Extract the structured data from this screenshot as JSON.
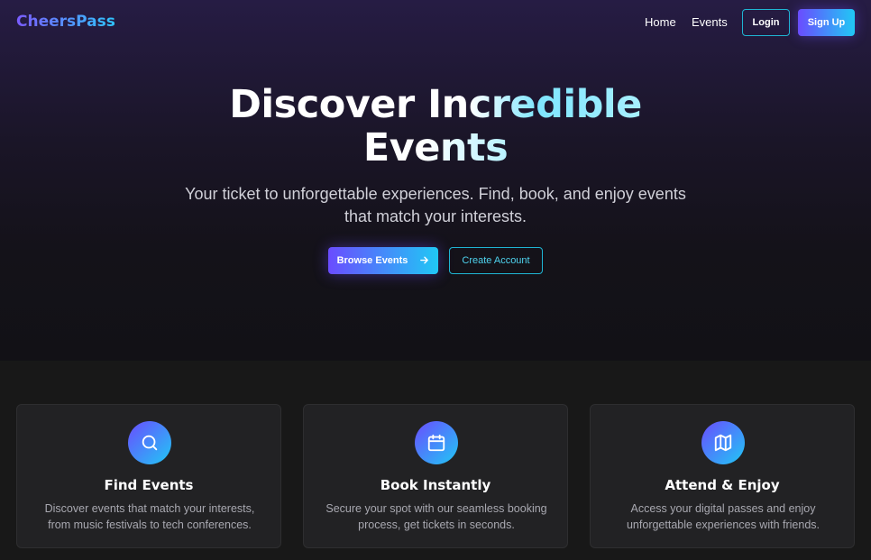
{
  "nav": {
    "logo": "CheersPass",
    "links": [
      "Home",
      "Events"
    ],
    "login_label": "Login",
    "signup_label": "Sign Up"
  },
  "hero": {
    "title_part1": "Discover In",
    "title_part2": "credible",
    "title_part3": "Events",
    "subtitle": "Your ticket to unforgettable experiences. Find, book, and enjoy events that match your interests.",
    "browse_label": "Browse Events",
    "browse_icon": "arrow-right-icon",
    "create_label": "Create Account"
  },
  "features": [
    {
      "icon": "search-icon",
      "title": "Find Events",
      "description": "Discover events that match your interests, from music festivals to tech conferences."
    },
    {
      "icon": "calendar-icon",
      "title": "Book Instantly",
      "description": "Secure your spot with our seamless booking process, get tickets in seconds."
    },
    {
      "icon": "map-icon",
      "title": "Attend & Enjoy",
      "description": "Access your digital passes and enjoy unforgettable experiences with friends."
    }
  ],
  "colors": {
    "accent_purple": "#6a4cff",
    "accent_cyan": "#20c8f5",
    "background": "#171717",
    "card": "#222224"
  }
}
